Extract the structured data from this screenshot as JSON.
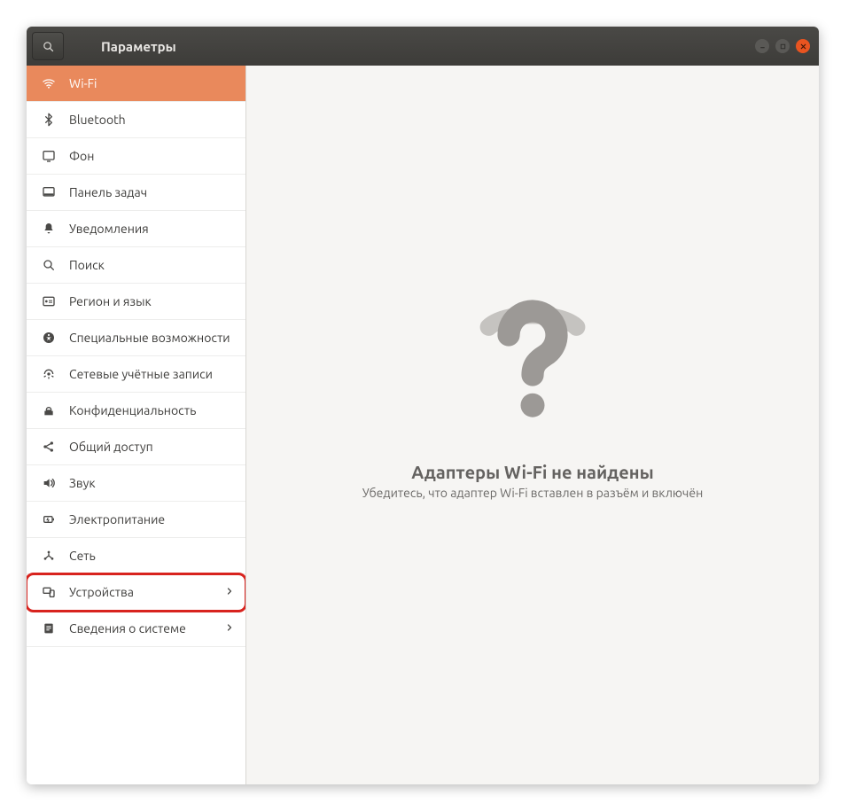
{
  "window": {
    "title": "Параметры"
  },
  "sidebar": {
    "items": [
      {
        "id": "wifi",
        "label": "Wi-Fi",
        "icon": "wifi-icon",
        "selected": true,
        "chevron": false,
        "highlight": false
      },
      {
        "id": "bluetooth",
        "label": "Bluetooth",
        "icon": "bluetooth-icon",
        "selected": false,
        "chevron": false,
        "highlight": false
      },
      {
        "id": "background",
        "label": "Фон",
        "icon": "background-icon",
        "selected": false,
        "chevron": false,
        "highlight": false
      },
      {
        "id": "dock",
        "label": "Панель задач",
        "icon": "dock-icon",
        "selected": false,
        "chevron": false,
        "highlight": false
      },
      {
        "id": "notifications",
        "label": "Уведомления",
        "icon": "bell-icon",
        "selected": false,
        "chevron": false,
        "highlight": false
      },
      {
        "id": "search",
        "label": "Поиск",
        "icon": "search-icon",
        "selected": false,
        "chevron": false,
        "highlight": false
      },
      {
        "id": "region",
        "label": "Регион и язык",
        "icon": "region-icon",
        "selected": false,
        "chevron": false,
        "highlight": false
      },
      {
        "id": "accessibility",
        "label": "Специальные возможности",
        "icon": "accessibility-icon",
        "selected": false,
        "chevron": false,
        "highlight": false
      },
      {
        "id": "online-accts",
        "label": "Сетевые учётные записи",
        "icon": "accounts-icon",
        "selected": false,
        "chevron": false,
        "highlight": false
      },
      {
        "id": "privacy",
        "label": "Конфиденциальность",
        "icon": "privacy-icon",
        "selected": false,
        "chevron": false,
        "highlight": false
      },
      {
        "id": "sharing",
        "label": "Общий доступ",
        "icon": "sharing-icon",
        "selected": false,
        "chevron": false,
        "highlight": false
      },
      {
        "id": "sound",
        "label": "Звук",
        "icon": "sound-icon",
        "selected": false,
        "chevron": false,
        "highlight": false
      },
      {
        "id": "power",
        "label": "Электропитание",
        "icon": "power-icon",
        "selected": false,
        "chevron": false,
        "highlight": false
      },
      {
        "id": "network",
        "label": "Сеть",
        "icon": "network-icon",
        "selected": false,
        "chevron": false,
        "highlight": false
      },
      {
        "id": "devices",
        "label": "Устройства",
        "icon": "devices-icon",
        "selected": false,
        "chevron": true,
        "highlight": true
      },
      {
        "id": "details",
        "label": "Сведения о системе",
        "icon": "details-icon",
        "selected": false,
        "chevron": true,
        "highlight": false
      }
    ]
  },
  "main": {
    "heading": "Адаптеры Wi-Fi не найдены",
    "subtext": "Убедитесь, что адаптер Wi-Fi вставлен в разъём и включён"
  },
  "colors": {
    "accent": "#e9895c",
    "highlight_border": "#d8231e",
    "close_button": "#e95420"
  }
}
